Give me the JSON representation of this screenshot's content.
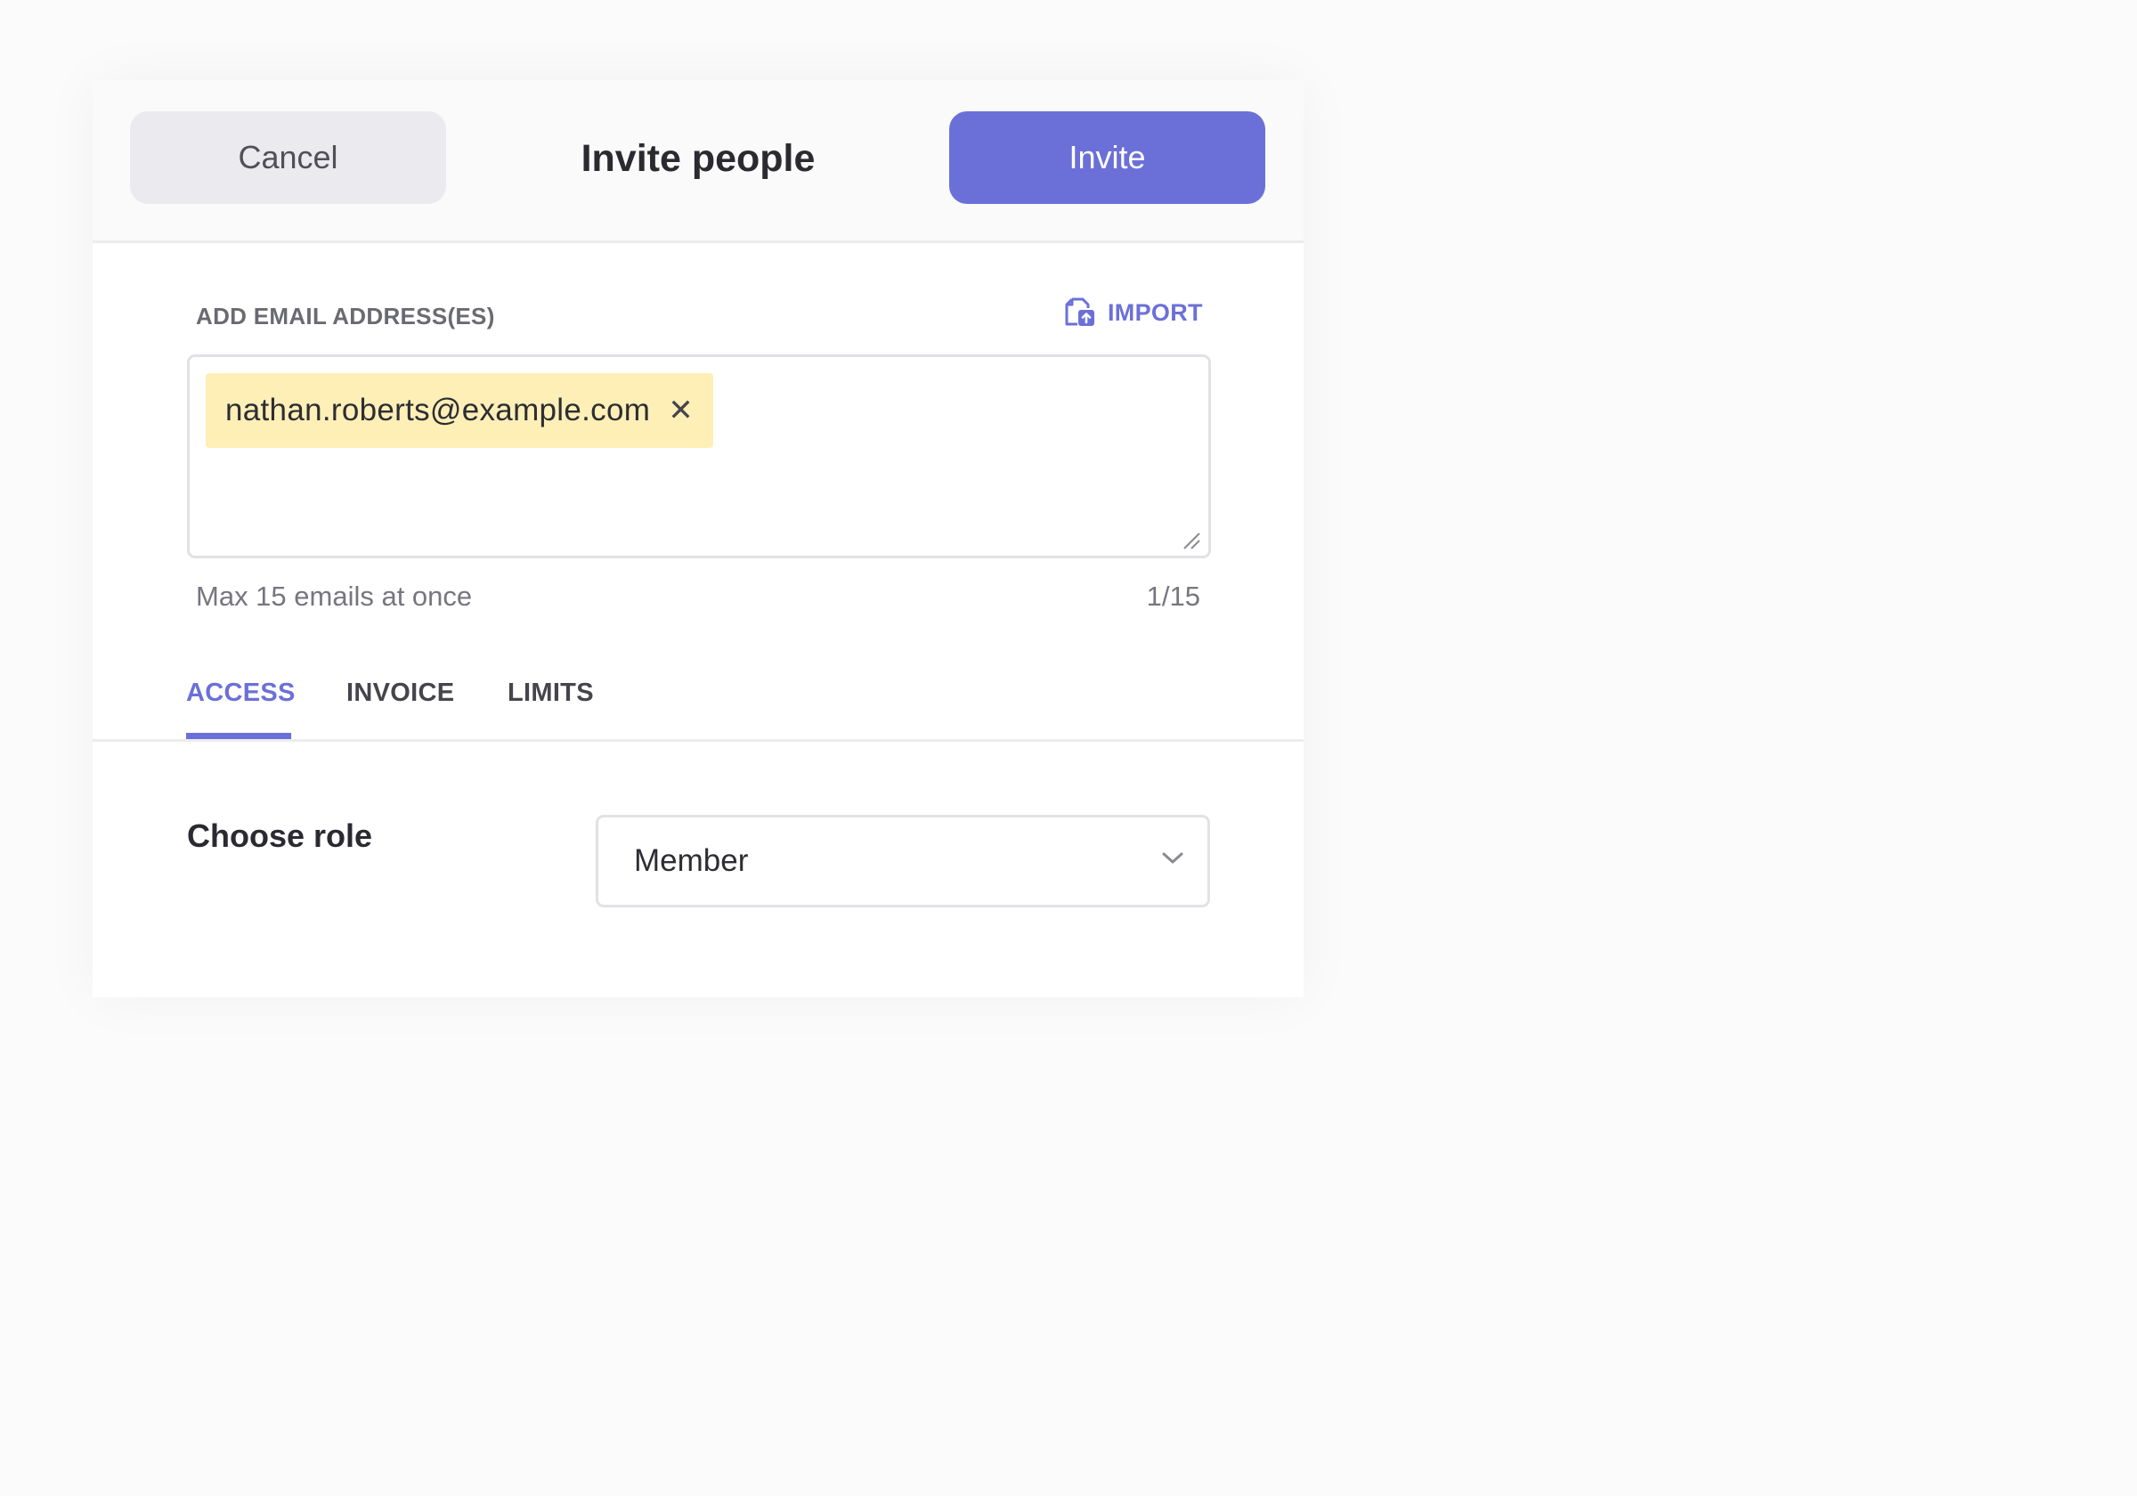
{
  "header": {
    "cancel_label": "Cancel",
    "title": "Invite people",
    "invite_label": "Invite"
  },
  "emails": {
    "label": "ADD EMAIL ADDRESS(ES)",
    "import_label": "IMPORT",
    "chips": [
      {
        "value": "nathan.roberts@example.com"
      }
    ],
    "chip_remove_glyph": "✕",
    "hint": "Max 15 emails at once",
    "count": "1/15"
  },
  "tabs": [
    {
      "label": "ACCESS",
      "active": true
    },
    {
      "label": "INVOICE",
      "active": false
    },
    {
      "label": "LIMITS",
      "active": false
    }
  ],
  "role": {
    "label": "Choose role",
    "selected": "Member"
  },
  "colors": {
    "accent": "#6b70d8",
    "chip_bg": "#fdefb6",
    "cancel_bg": "#ebebef"
  },
  "icons": {
    "import": "file-import-icon",
    "remove": "close-icon",
    "dropdown": "chevron-down-icon",
    "resize": "resize-handle-icon"
  }
}
